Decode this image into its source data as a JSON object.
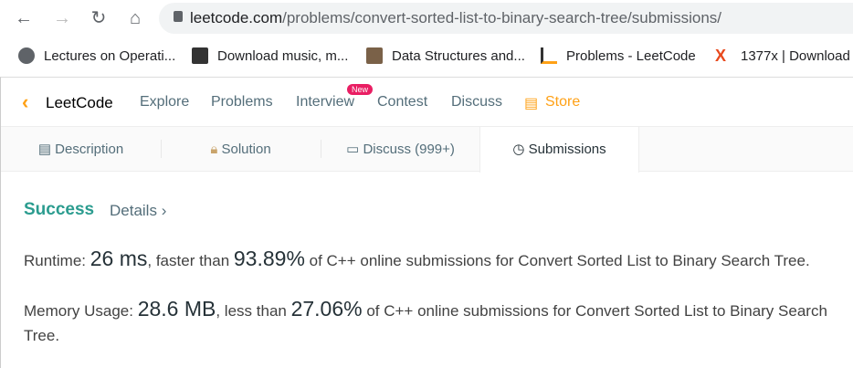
{
  "browser": {
    "url_host": "leetcode.com",
    "url_path": "/problems/convert-sorted-list-to-binary-search-tree/submissions/",
    "bookmarks": [
      "Lectures on Operati...",
      "Download music, m...",
      "Data Structures and...",
      "Problems - LeetCode",
      "1377x | Download"
    ]
  },
  "nav": {
    "brand": "LeetCode",
    "items": [
      "Explore",
      "Problems",
      "Interview",
      "Contest",
      "Discuss"
    ],
    "store": "Store",
    "new_badge": "New"
  },
  "tabs": [
    "Description",
    "Solution",
    "Discuss (999+)",
    "Submissions"
  ],
  "result": {
    "status": "Success",
    "details": "Details",
    "details_arrow": "›",
    "runtime_label": "Runtime: ",
    "runtime": "26 ms",
    "runtime_mid": ", faster than ",
    "runtime_pct": "93.89%",
    "runtime_tail": " of C++ online submissions for Convert Sorted List to Binary Search Tree.",
    "memory_label": "Memory Usage: ",
    "memory": "28.6 MB",
    "memory_mid": ", less than ",
    "memory_pct": "27.06%",
    "memory_tail": " of C++ online submissions for Convert Sorted List to Binary Search Tree."
  },
  "colors": {
    "success": "#2db55d",
    "store": "#ffa116",
    "new": "#e91e63"
  }
}
